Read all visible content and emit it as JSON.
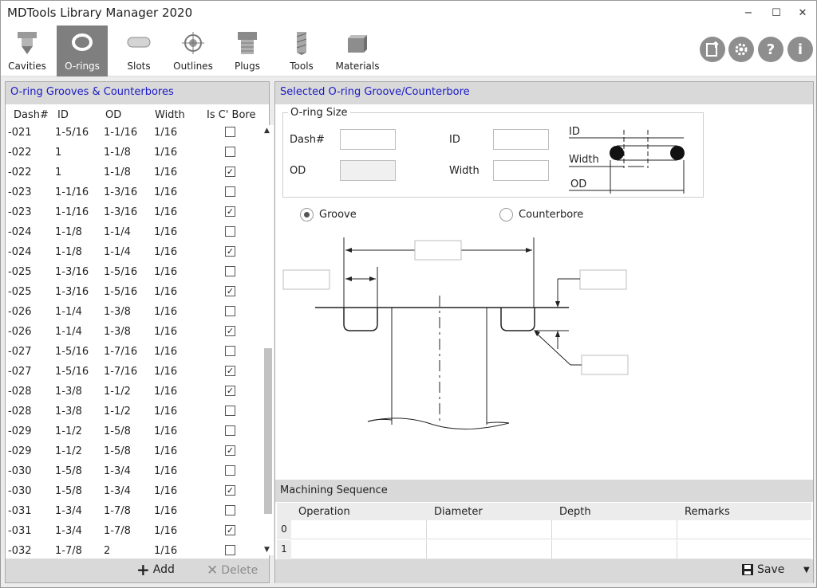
{
  "window": {
    "title": "MDTools Library Manager 2020",
    "minimize": "−",
    "maximize": "☐",
    "close": "✕"
  },
  "toolbar": {
    "items": [
      {
        "label": "Cavities",
        "icon": "cavity-icon"
      },
      {
        "label": "O-rings",
        "icon": "oring-icon",
        "active": true
      },
      {
        "label": "Slots",
        "icon": "slot-icon"
      },
      {
        "label": "Outlines",
        "icon": "outline-icon"
      },
      {
        "label": "Plugs",
        "icon": "plug-icon"
      },
      {
        "label": "Tools",
        "icon": "tool-icon"
      },
      {
        "label": "Materials",
        "icon": "material-icon"
      }
    ],
    "right_buttons": [
      "import-icon",
      "settings-icon",
      "help-icon",
      "info-icon"
    ]
  },
  "left_panel": {
    "title": "O-ring Grooves  &  Counterbores",
    "columns": [
      "Dash#",
      "ID",
      "OD",
      "Width",
      "Is C' Bore"
    ],
    "rows": [
      {
        "dash": "-021",
        "id": "1-5/16",
        "od": "1-1/16",
        "width": "1/16",
        "cbore": false
      },
      {
        "dash": "-022",
        "id": "1",
        "od": "1-1/8",
        "width": "1/16",
        "cbore": false
      },
      {
        "dash": "-022",
        "id": "1",
        "od": "1-1/8",
        "width": "1/16",
        "cbore": true
      },
      {
        "dash": "-023",
        "id": "1-1/16",
        "od": "1-3/16",
        "width": "1/16",
        "cbore": false
      },
      {
        "dash": "-023",
        "id": "1-1/16",
        "od": "1-3/16",
        "width": "1/16",
        "cbore": true
      },
      {
        "dash": "-024",
        "id": "1-1/8",
        "od": "1-1/4",
        "width": "1/16",
        "cbore": false
      },
      {
        "dash": "-024",
        "id": "1-1/8",
        "od": "1-1/4",
        "width": "1/16",
        "cbore": true
      },
      {
        "dash": "-025",
        "id": "1-3/16",
        "od": "1-5/16",
        "width": "1/16",
        "cbore": false
      },
      {
        "dash": "-025",
        "id": "1-3/16",
        "od": "1-5/16",
        "width": "1/16",
        "cbore": true
      },
      {
        "dash": "-026",
        "id": "1-1/4",
        "od": "1-3/8",
        "width": "1/16",
        "cbore": false
      },
      {
        "dash": "-026",
        "id": "1-1/4",
        "od": "1-3/8",
        "width": "1/16",
        "cbore": true
      },
      {
        "dash": "-027",
        "id": "1-5/16",
        "od": "1-7/16",
        "width": "1/16",
        "cbore": false
      },
      {
        "dash": "-027",
        "id": "1-5/16",
        "od": "1-7/16",
        "width": "1/16",
        "cbore": true
      },
      {
        "dash": "-028",
        "id": "1-3/8",
        "od": "1-1/2",
        "width": "1/16",
        "cbore": true
      },
      {
        "dash": "-028",
        "id": "1-3/8",
        "od": "1-1/2",
        "width": "1/16",
        "cbore": false
      },
      {
        "dash": "-029",
        "id": "1-1/2",
        "od": "1-5/8",
        "width": "1/16",
        "cbore": false
      },
      {
        "dash": "-029",
        "id": "1-1/2",
        "od": "1-5/8",
        "width": "1/16",
        "cbore": true
      },
      {
        "dash": "-030",
        "id": "1-5/8",
        "od": "1-3/4",
        "width": "1/16",
        "cbore": false
      },
      {
        "dash": "-030",
        "id": "1-5/8",
        "od": "1-3/4",
        "width": "1/16",
        "cbore": true
      },
      {
        "dash": "-031",
        "id": "1-3/4",
        "od": "1-7/8",
        "width": "1/16",
        "cbore": false
      },
      {
        "dash": "-031",
        "id": "1-3/4",
        "od": "1-7/8",
        "width": "1/16",
        "cbore": true
      },
      {
        "dash": "-032",
        "id": "1-7/8",
        "od": "2",
        "width": "1/16",
        "cbore": false
      }
    ],
    "add_label": "Add",
    "delete_label": "Delete"
  },
  "right_panel": {
    "title": "Selected O-ring Groove/Counterbore",
    "oring_size": {
      "legend": "O-ring Size",
      "dash_label": "Dash#",
      "id_label": "ID",
      "od_label": "OD",
      "width_label": "Width",
      "dash_value": "",
      "id_value": "",
      "od_value": "",
      "width_value": ""
    },
    "diagram_labels": {
      "id": "ID",
      "width": "Width",
      "od": "OD"
    },
    "groove_label": "Groove",
    "counterbore_label": "Counterbore",
    "selected_type": "groove",
    "machining": {
      "title": "Machining Sequence",
      "columns": [
        "Operation",
        "Diameter",
        "Depth",
        "Remarks"
      ],
      "rows": [
        {
          "index": "0",
          "operation": "",
          "diameter": "",
          "depth": "",
          "remarks": ""
        },
        {
          "index": "1",
          "operation": "",
          "diameter": "",
          "depth": "",
          "remarks": ""
        }
      ]
    },
    "save_label": "Save"
  }
}
